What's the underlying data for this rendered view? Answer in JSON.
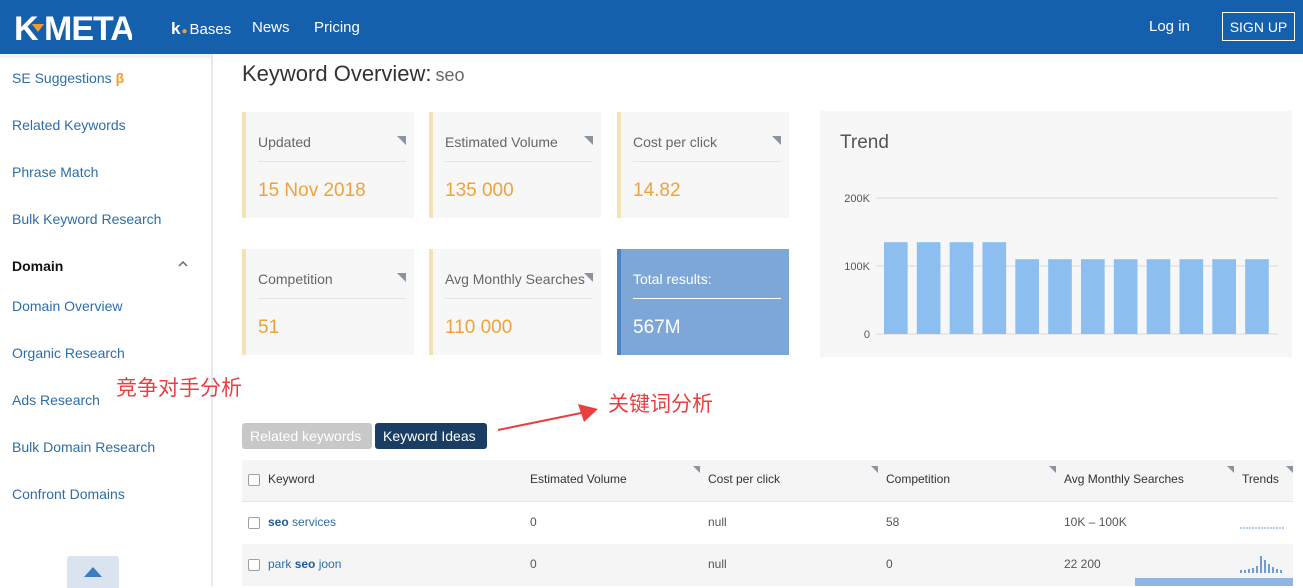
{
  "header": {
    "logo_text": "K META",
    "nav": {
      "kbases_k": "k",
      "kbases_label": "Bases",
      "news": "News",
      "pricing": "Pricing"
    },
    "login": "Log in",
    "signup": "SIGN UP"
  },
  "sidebar": {
    "items_top": [
      {
        "label": "SE Suggestions",
        "badge": "β"
      },
      {
        "label": "Related Keywords"
      },
      {
        "label": "Phrase Match"
      },
      {
        "label": "Bulk Keyword Research"
      }
    ],
    "section": "Domain",
    "items_domain": [
      {
        "label": "Domain Overview"
      },
      {
        "label": "Organic Research"
      },
      {
        "label": "Ads Research"
      },
      {
        "label": "Bulk Domain Research"
      },
      {
        "label": "Confront Domains"
      }
    ]
  },
  "overview": {
    "title": "Keyword Overview:",
    "keyword": "seo",
    "cards": [
      {
        "label": "Updated",
        "value": "15 Nov 2018"
      },
      {
        "label": "Estimated Volume",
        "value": "135 000"
      },
      {
        "label": "Cost per click",
        "value": "14.82"
      },
      {
        "label": "Competition",
        "value": "51"
      },
      {
        "label": "Avg Monthly Searches",
        "value": "110 000"
      },
      {
        "label": "Total results:",
        "value": "567M"
      }
    ]
  },
  "chart_data": {
    "type": "bar",
    "title": "Trend",
    "y_ticks": [
      "200K",
      "100K",
      "0"
    ],
    "ylim": [
      0,
      200000
    ],
    "values": [
      135000,
      135000,
      135000,
      135000,
      110000,
      110000,
      110000,
      110000,
      110000,
      110000,
      110000,
      110000
    ],
    "bar_color": "#8cbff0",
    "grid": true
  },
  "annotations": {
    "competitor": "竞争对手分析",
    "keyword": "关键词分析"
  },
  "tabs": {
    "related": "Related keywords",
    "ideas": "Keyword Ideas"
  },
  "table": {
    "headers": [
      "Keyword",
      "Estimated Volume",
      "Cost per click",
      "Competition",
      "Avg Monthly Searches",
      "Trends"
    ],
    "rows": [
      {
        "kw_bold": "seo",
        "kw_rest": " services",
        "volume": "0",
        "cpc": "null",
        "competition": "58",
        "avg": "10K – 100K"
      },
      {
        "kw_pre": "park ",
        "kw_bold": "seo",
        "kw_rest": " joon",
        "volume": "0",
        "cpc": "null",
        "competition": "0",
        "avg": "22 200"
      }
    ]
  },
  "colors": {
    "header_bg": "#1560ad",
    "accent": "#f39a2b",
    "link": "#2d6ea8",
    "value_orange": "#f0a23a",
    "total_card": "#7da7d6",
    "tab_active": "#1a3e63",
    "annotation_red": "#e84040"
  }
}
